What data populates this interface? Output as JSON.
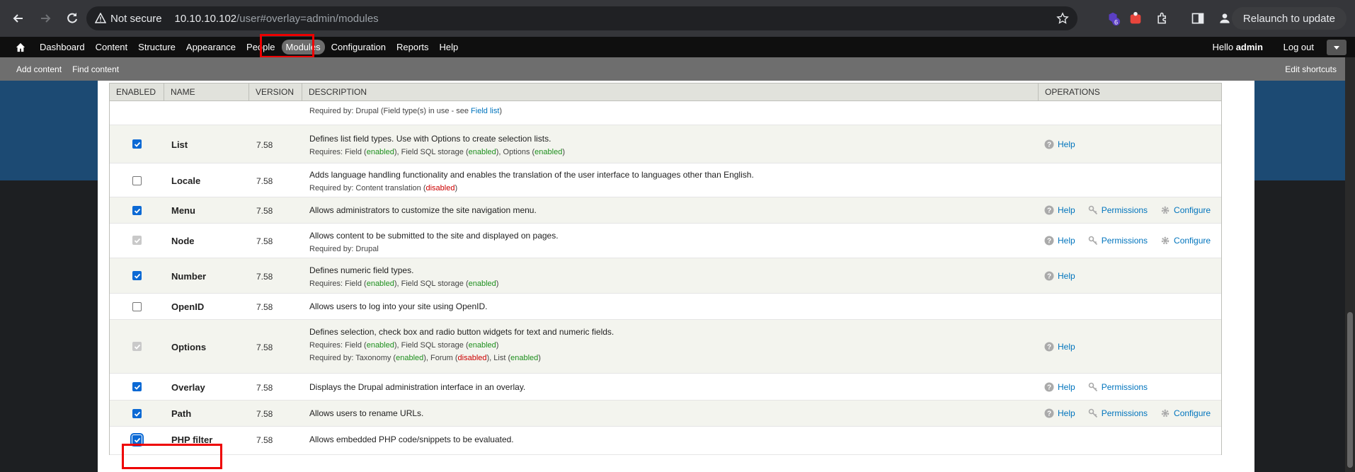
{
  "browser": {
    "security_label": "Not secure",
    "url_host": "10.10.10.102",
    "url_path": "/user#overlay=admin/modules",
    "relaunch_label": "Relaunch to update",
    "extension_badge": "6"
  },
  "toolbar": {
    "items": [
      "Dashboard",
      "Content",
      "Structure",
      "Appearance",
      "People",
      "Modules",
      "Configuration",
      "Reports",
      "Help"
    ],
    "hello_prefix": "Hello ",
    "username": "admin",
    "logout": "Log out"
  },
  "shortcuts": {
    "add_content": "Add content",
    "find_content": "Find content",
    "edit_shortcuts": "Edit shortcuts"
  },
  "table": {
    "headers": [
      "ENABLED",
      "NAME",
      "VERSION",
      "DESCRIPTION",
      "OPERATIONS"
    ]
  },
  "rows": {
    "field_partial": {
      "required_prefix": "Required by: Drupal (Field type(s) in use - see ",
      "field_list_link": "Field list",
      "required_suffix": ")"
    },
    "list": {
      "name": "List",
      "version": "7.58",
      "desc": "Defines list field types. Use with Options to create selection lists.",
      "req": "Requires: Field (",
      "en": "enabled",
      "req2": "), Field SQL storage (",
      "req3": "), Options (",
      "close": ")",
      "help": "Help"
    },
    "locale": {
      "name": "Locale",
      "version": "7.58",
      "desc": "Adds language handling functionality and enables the translation of the user interface to languages other than English.",
      "req": "Required by: Content translation (",
      "dis": "disabled",
      "close": ")"
    },
    "menu": {
      "name": "Menu",
      "version": "7.58",
      "desc": "Allows administrators to customize the site navigation menu.",
      "help": "Help",
      "permissions": "Permissions",
      "configure": "Configure"
    },
    "node": {
      "name": "Node",
      "version": "7.58",
      "desc": "Allows content to be submitted to the site and displayed on pages.",
      "req": "Required by: Drupal",
      "help": "Help",
      "permissions": "Permissions",
      "configure": "Configure"
    },
    "number": {
      "name": "Number",
      "version": "7.58",
      "desc": "Defines numeric field types.",
      "req": "Requires: Field (",
      "en": "enabled",
      "req2": "), Field SQL storage (",
      "close": ")",
      "help": "Help"
    },
    "openid": {
      "name": "OpenID",
      "version": "7.58",
      "desc": "Allows users to log into your site using OpenID."
    },
    "options": {
      "name": "Options",
      "version": "7.58",
      "desc": "Defines selection, check box and radio button widgets for text and numeric fields.",
      "req": "Requires: Field (",
      "en": "enabled",
      "req2": "), Field SQL storage (",
      "close": ")",
      "reqby": "Required by: Taxonomy (",
      "reqby2": "), Forum (",
      "dis": "disabled",
      "reqby3": "), List (",
      "help": "Help"
    },
    "overlay": {
      "name": "Overlay",
      "version": "7.58",
      "desc": "Displays the Drupal administration interface in an overlay.",
      "help": "Help",
      "permissions": "Permissions"
    },
    "path": {
      "name": "Path",
      "version": "7.58",
      "desc": "Allows users to rename URLs.",
      "help": "Help",
      "permissions": "Permissions",
      "configure": "Configure"
    },
    "php": {
      "name": "PHP filter",
      "version": "7.58",
      "desc": "Allows embedded PHP code/snippets to be evaluated."
    }
  },
  "colors": {
    "link": "#0074bd",
    "enabled": "#1e8f1e",
    "disabled": "#c00",
    "highlight": "#ee0000"
  }
}
